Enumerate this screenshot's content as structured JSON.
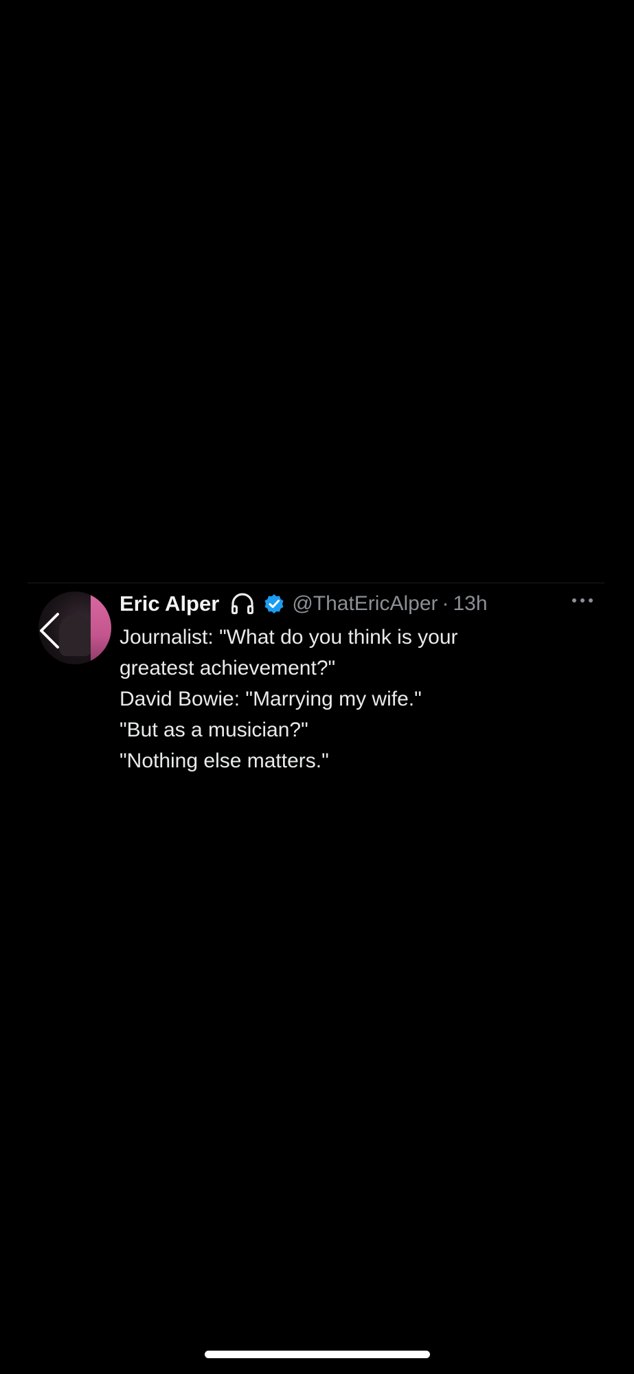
{
  "tweet": {
    "display_name": "Eric Alper",
    "handle": "@ThatEricAlper",
    "separator": "·",
    "time": "13h",
    "lines": [
      "Journalist: \"What do you think is your",
      "greatest achievement?\"",
      "David Bowie: \"Marrying my wife.\"",
      "\"But as a musician?\"",
      "\"Nothing else matters.\""
    ]
  },
  "icons": {
    "back": "chevron-left-icon",
    "headphones": "headphones-icon",
    "verified": "verified-badge-icon",
    "more": "more-horizontal-icon"
  },
  "colors": {
    "background": "#000000",
    "text": "#e7e9ea",
    "secondary_text": "#8b9096",
    "verified_blue": "#1d9bf0",
    "avatar_accent": "#d86aa0"
  }
}
